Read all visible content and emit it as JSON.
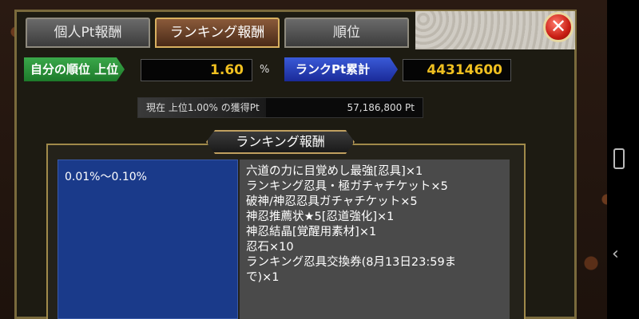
{
  "tabs": [
    {
      "label": "個人Pt報酬"
    },
    {
      "label": "ランキング報酬"
    },
    {
      "label": "順位"
    }
  ],
  "close_label": "✕",
  "stats": {
    "rank_label": "自分の順位 上位",
    "rank_value": "1.60",
    "rank_unit": "%",
    "total_label": "ランクPt累計",
    "total_value": "44314600"
  },
  "progress": {
    "label": "現在 上位1.00% の獲得Pt",
    "value": "57,186,800 Pt",
    "fraction": 0.45
  },
  "section": {
    "title": "ランキング報酬",
    "tier": "0.01%〜0.10%",
    "rewards": [
      "六道の力に目覚めし最強[忍具]×1",
      "ランキング忍具・極ガチャチケット×5",
      "破神/神忍忍具ガチャチケット×5",
      "神忍推薦状★5[忍道強化]×1",
      "神忍結晶[覚醒用素材]×1",
      "忍石×10",
      "ランキング忍具交換券(8月13日23:59ま",
      "で)×1"
    ]
  },
  "nav": {
    "recent_icon": "recent-apps-icon",
    "back_icon": "back-icon",
    "back_glyph": "‹"
  }
}
